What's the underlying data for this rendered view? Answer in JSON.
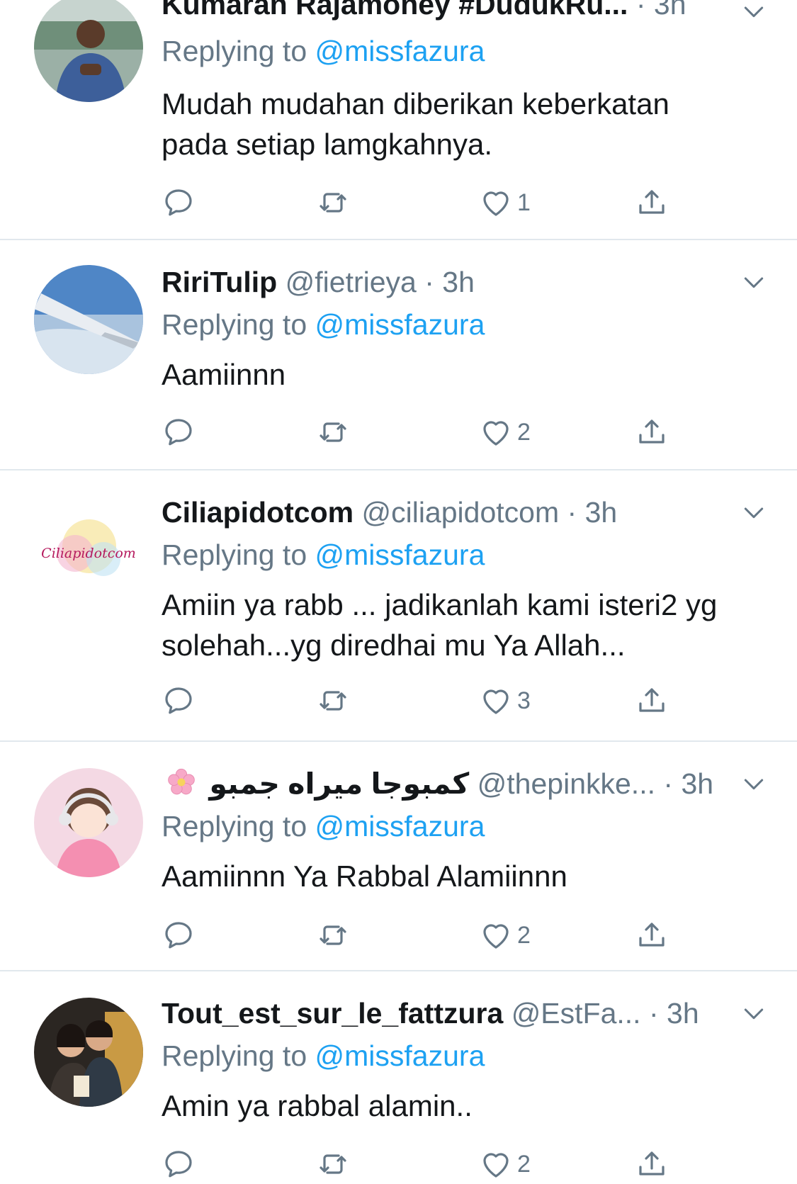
{
  "tweets": [
    {
      "name": "Kumaran Rajamoney #DudukRu...",
      "handle": "",
      "dot": "·",
      "time": "3h",
      "reply_prefix": "Replying to",
      "reply_to": "@missfazura",
      "text": "Mudah mudahan diberikan keberkatan pada setiap lamgkahnya.",
      "likes": "1",
      "avatar": "man-portrait"
    },
    {
      "name": "RiriTulip",
      "handle": "@fietrieya",
      "dot": "·",
      "time": "3h",
      "reply_prefix": "Replying to",
      "reply_to": "@missfazura",
      "text": "Aamiinnn",
      "likes": "2",
      "avatar": "airplane-wing"
    },
    {
      "name": "Ciliapidotcom",
      "handle": "@ciliapidotcom",
      "dot": "·",
      "time": "3h",
      "reply_prefix": "Replying to",
      "reply_to": "@missfazura",
      "text": "Amiin ya rabb ... jadikanlah kami isteri2 yg solehah...yg diredhai mu Ya Allah...",
      "likes": "3",
      "avatar": "ciliapidotcom-logo",
      "avatar_text": "Ciliapidotcom"
    },
    {
      "name": "كمبوجا ميراه جمبو",
      "handle": "@thepinkke...",
      "dot": "·",
      "time": "3h",
      "reply_prefix": "Replying to",
      "reply_to": "@missfazura",
      "text": "Aamiinnn Ya Rabbal Alamiinnn",
      "likes": "2",
      "avatar": "anime-girl-headphones"
    },
    {
      "name": "Tout_est_sur_le_fattzura",
      "handle": "@EstFa...",
      "dot": "·",
      "time": "3h",
      "reply_prefix": "Replying to",
      "reply_to": "@missfazura",
      "text": "Amin ya rabbal alamin..",
      "likes": "2",
      "avatar": "couple-photo"
    }
  ],
  "icons": {
    "reply": "reply-bubble-icon",
    "retweet": "retweet-icon",
    "like": "heart-icon",
    "share": "share-icon",
    "menu": "chevron-down-icon",
    "flower": "cherry-blossom-icon"
  },
  "colors": {
    "text": "#14171a",
    "secondary": "#657786",
    "link": "#1da1f2",
    "divider": "#e1e8ed"
  }
}
